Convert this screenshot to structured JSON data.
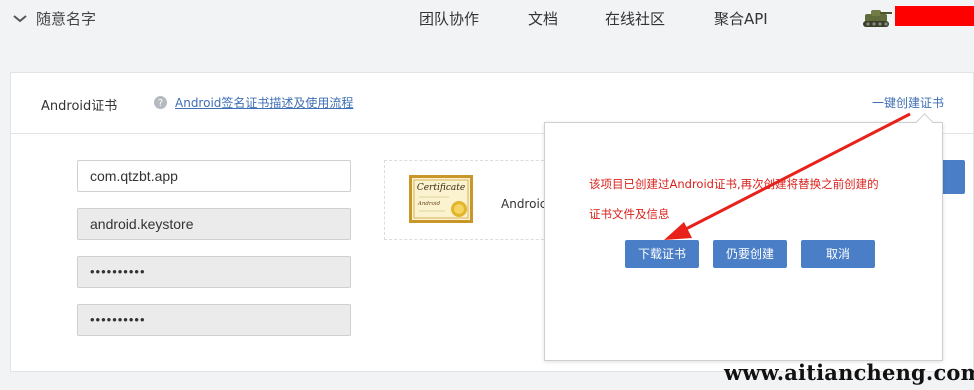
{
  "header": {
    "project_name": "随意名字",
    "nav": [
      "团队协作",
      "文档",
      "在线社区",
      "聚合API"
    ]
  },
  "card": {
    "title": "Android证书",
    "help_link": "Android签名证书描述及使用流程",
    "one_click_create": "一键创建证书"
  },
  "form": {
    "package_name": "com.qtzbt.app",
    "keystore": "android.keystore",
    "password": "••••••••••",
    "alias_password": "••••••••••"
  },
  "cert": {
    "image_text": "Certificate",
    "image_subtext": "Android",
    "label": "Androic"
  },
  "popover": {
    "message_line1": "该项目已创建过Android证书,再次创建将替换之前创建的",
    "message_line2": "证书文件及信息",
    "buttons": {
      "download": "下载证书",
      "recreate": "仍要创建",
      "cancel": "取消"
    }
  },
  "watermark": "www.aitiancheng.com",
  "colors": {
    "link": "#3f6fb5",
    "primary_button": "#4a7ec7",
    "warning_text": "#d9211b",
    "annotation_arrow": "#e8211a",
    "redaction": "#ff0000"
  },
  "icons": [
    "chevron-down-icon",
    "help-icon",
    "avatar-tank-icon",
    "certificate-icon"
  ]
}
